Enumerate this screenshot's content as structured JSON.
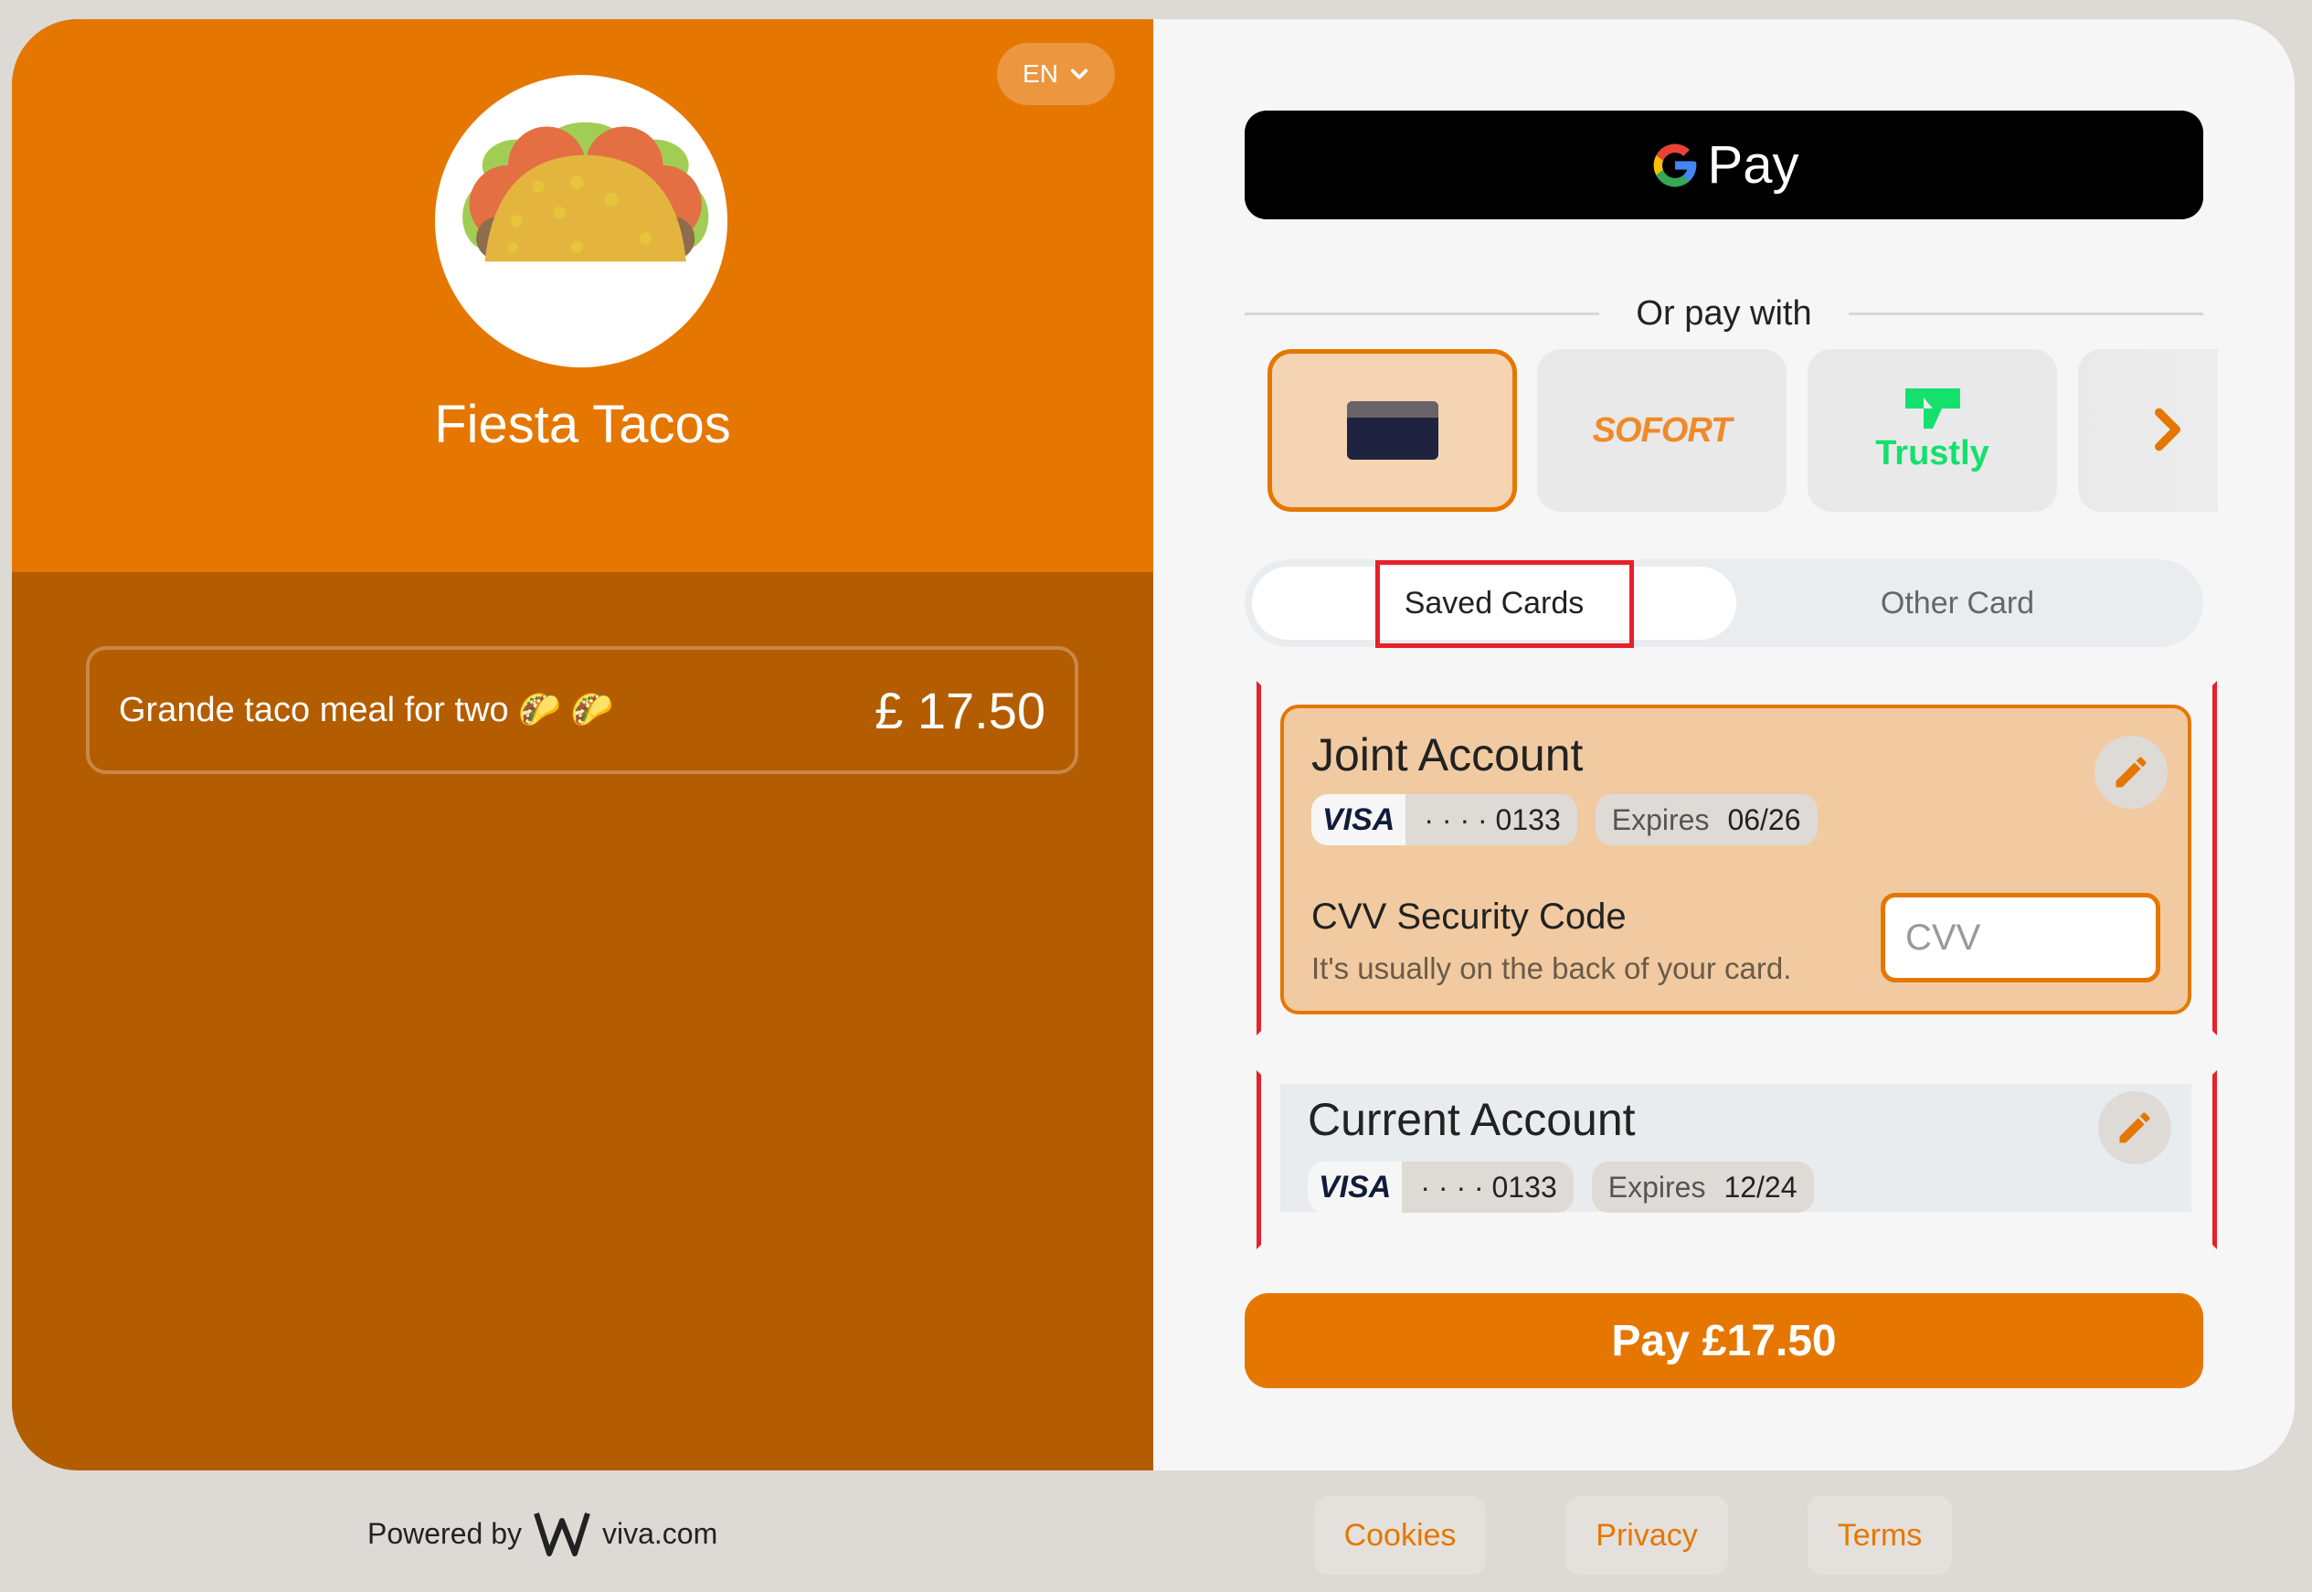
{
  "merchant": {
    "name": "Fiesta Tacos",
    "logo_icon": "taco-logo"
  },
  "language": {
    "selected": "EN",
    "icon": "chevron-down-icon"
  },
  "order": {
    "description": "Grande taco meal for two",
    "emoji": [
      "🌮",
      "🌮"
    ],
    "price": "£ 17.50"
  },
  "wallet": {
    "gpay_label": "Pay",
    "gpay_icon": "google-g-icon"
  },
  "divider_text": "Or pay with",
  "payment_methods": [
    {
      "name": "card",
      "icon": "credit-card-icon",
      "active": true
    },
    {
      "name": "SOFORT",
      "label": "SOFORT",
      "active": false
    },
    {
      "name": "Trustly",
      "label": "Trustly",
      "active": false
    },
    {
      "name": "more",
      "icon": "chevron-right-icon",
      "active": false
    }
  ],
  "tabs": [
    {
      "label": "Saved Cards",
      "active": true
    },
    {
      "label": "Other Card",
      "active": false
    }
  ],
  "saved_cards": [
    {
      "name": "Joint Account",
      "brand": "VISA",
      "masked_number": "· · · · 0133",
      "expires_label": "Expires",
      "expires": "06/26",
      "selected": true,
      "cvv": {
        "label": "CVV Security Code",
        "hint": "It's usually on the back of your card.",
        "placeholder": "CVV",
        "value": ""
      }
    },
    {
      "name": "Current Account",
      "brand": "VISA",
      "masked_number": "· · · · 0133",
      "expires_label": "Expires",
      "expires": "12/24",
      "selected": false
    }
  ],
  "pay_button": {
    "label": "Pay",
    "amount": "£17.50"
  },
  "footer": {
    "powered_by": "Powered by",
    "brand": "viva.com",
    "links": [
      "Cookies",
      "Privacy",
      "Terms"
    ]
  },
  "colors": {
    "accent": "#e57700",
    "accent_dark": "#b45d00",
    "selected_card_bg": "#f1caa1",
    "annotation": "#e8202a"
  }
}
